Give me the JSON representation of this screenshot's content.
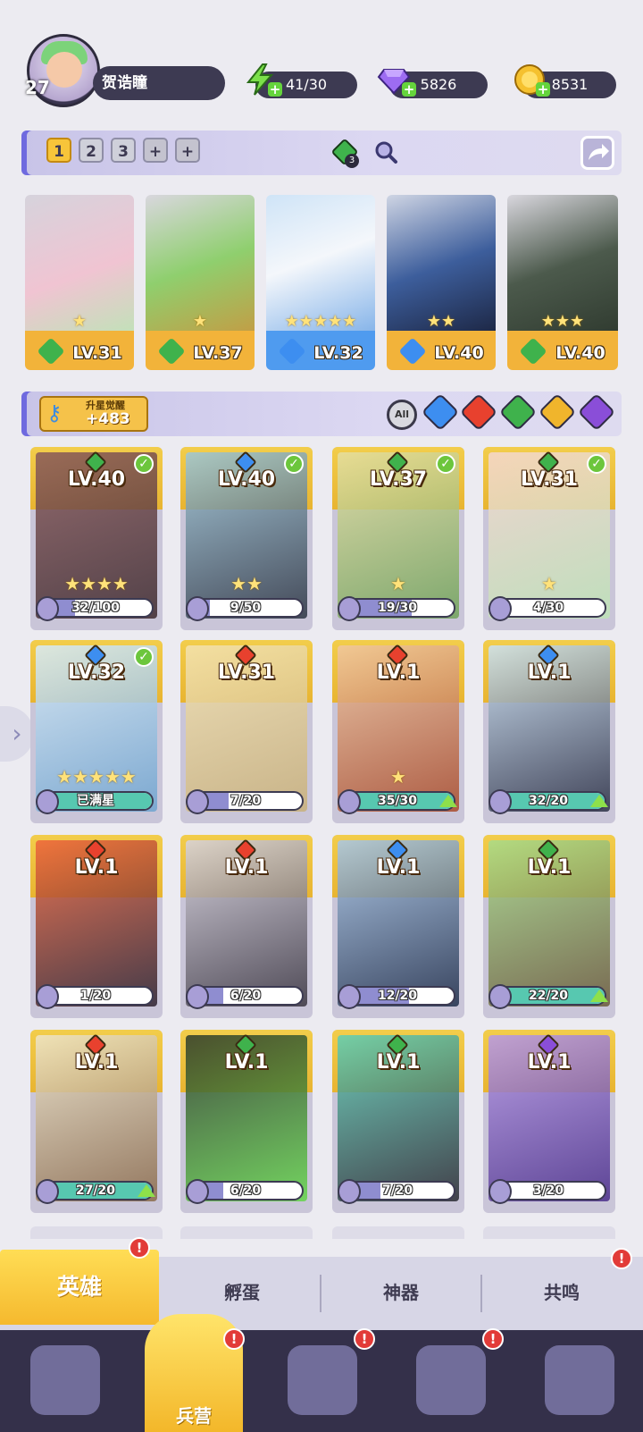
{
  "player": {
    "level": "27",
    "name": "贺诰瞳"
  },
  "resources": {
    "energy": "41/30",
    "gems": "5826",
    "coins": "8531"
  },
  "team_bar": {
    "slots": [
      "1",
      "2",
      "3"
    ],
    "add_slots": [
      "+",
      "+"
    ],
    "selected_slot": "1",
    "element_counter": "3"
  },
  "team": [
    {
      "level": "LV.31",
      "element": "nature",
      "stars": "★"
    },
    {
      "level": "LV.37",
      "element": "nature",
      "stars": "★"
    },
    {
      "level": "LV.32",
      "element": "water",
      "stars": "★★★★★"
    },
    {
      "level": "LV.40",
      "element": "water",
      "stars": "★★"
    },
    {
      "level": "LV.40",
      "element": "nature",
      "stars": "★★★"
    }
  ],
  "awaken": {
    "title": "升星觉醒",
    "count": "+483"
  },
  "filters": {
    "all": "All",
    "elements": [
      "water",
      "fire",
      "nature",
      "light",
      "dark"
    ]
  },
  "heroes": [
    {
      "level": "LV.40",
      "element": "nature",
      "checked": true,
      "progress": "32/100",
      "fill": 0.32,
      "stars": "★★★★",
      "upgrade": false
    },
    {
      "level": "LV.40",
      "element": "water",
      "checked": true,
      "progress": "9/50",
      "fill": 0.18,
      "stars": "★★",
      "upgrade": false
    },
    {
      "level": "LV.37",
      "element": "nature",
      "checked": true,
      "progress": "19/30",
      "fill": 0.63,
      "stars": "★",
      "upgrade": false
    },
    {
      "level": "LV.31",
      "element": "nature",
      "checked": true,
      "progress": "4/30",
      "fill": 0.13,
      "stars": "★",
      "upgrade": false
    },
    {
      "level": "LV.32",
      "element": "water",
      "checked": true,
      "progress": "已满星",
      "fill": 1.0,
      "stars": "★★★★★",
      "upgrade": false
    },
    {
      "level": "LV.31",
      "element": "fire",
      "checked": false,
      "progress": "7/20",
      "fill": 0.35,
      "stars": "",
      "upgrade": false
    },
    {
      "level": "LV.1",
      "element": "fire",
      "checked": false,
      "progress": "35/30",
      "fill": 1.0,
      "stars": "★",
      "upgrade": true
    },
    {
      "level": "LV.1",
      "element": "water",
      "checked": false,
      "progress": "32/20",
      "fill": 1.0,
      "stars": "",
      "upgrade": true
    },
    {
      "level": "LV.1",
      "element": "fire",
      "checked": false,
      "progress": "1/20",
      "fill": 0.05,
      "stars": "",
      "upgrade": false
    },
    {
      "level": "LV.1",
      "element": "fire",
      "checked": false,
      "progress": "6/20",
      "fill": 0.3,
      "stars": "",
      "upgrade": false
    },
    {
      "level": "LV.1",
      "element": "water",
      "checked": false,
      "progress": "12/20",
      "fill": 0.6,
      "stars": "",
      "upgrade": false
    },
    {
      "level": "LV.1",
      "element": "nature",
      "checked": false,
      "progress": "22/20",
      "fill": 1.0,
      "stars": "",
      "upgrade": true
    },
    {
      "level": "LV.1",
      "element": "fire",
      "checked": false,
      "progress": "27/20",
      "fill": 1.0,
      "stars": "",
      "upgrade": true
    },
    {
      "level": "LV.1",
      "element": "nature",
      "checked": false,
      "progress": "6/20",
      "fill": 0.3,
      "stars": "",
      "upgrade": false
    },
    {
      "level": "LV.1",
      "element": "nature",
      "checked": false,
      "progress": "7/20",
      "fill": 0.35,
      "stars": "",
      "upgrade": false
    },
    {
      "level": "LV.1",
      "element": "dark",
      "checked": false,
      "progress": "3/20",
      "fill": 0.15,
      "stars": "",
      "upgrade": false
    }
  ],
  "tabs": [
    {
      "label": "英雄",
      "active": true,
      "badge": "!"
    },
    {
      "label": "孵蛋",
      "active": false,
      "badge": ""
    },
    {
      "label": "神器",
      "active": false,
      "badge": ""
    },
    {
      "label": "共鸣",
      "active": false,
      "badge": "!"
    }
  ],
  "nav": {
    "active_label": "兵营",
    "badges": [
      "!",
      "!",
      "!"
    ]
  },
  "colors": {
    "water": "#3d8ef0",
    "fire": "#e8412e",
    "nature": "#3fb24c",
    "light": "#f0b52c",
    "dark": "#8a4ed8",
    "gold": "#f2c443",
    "panel": "#3d3a52"
  }
}
